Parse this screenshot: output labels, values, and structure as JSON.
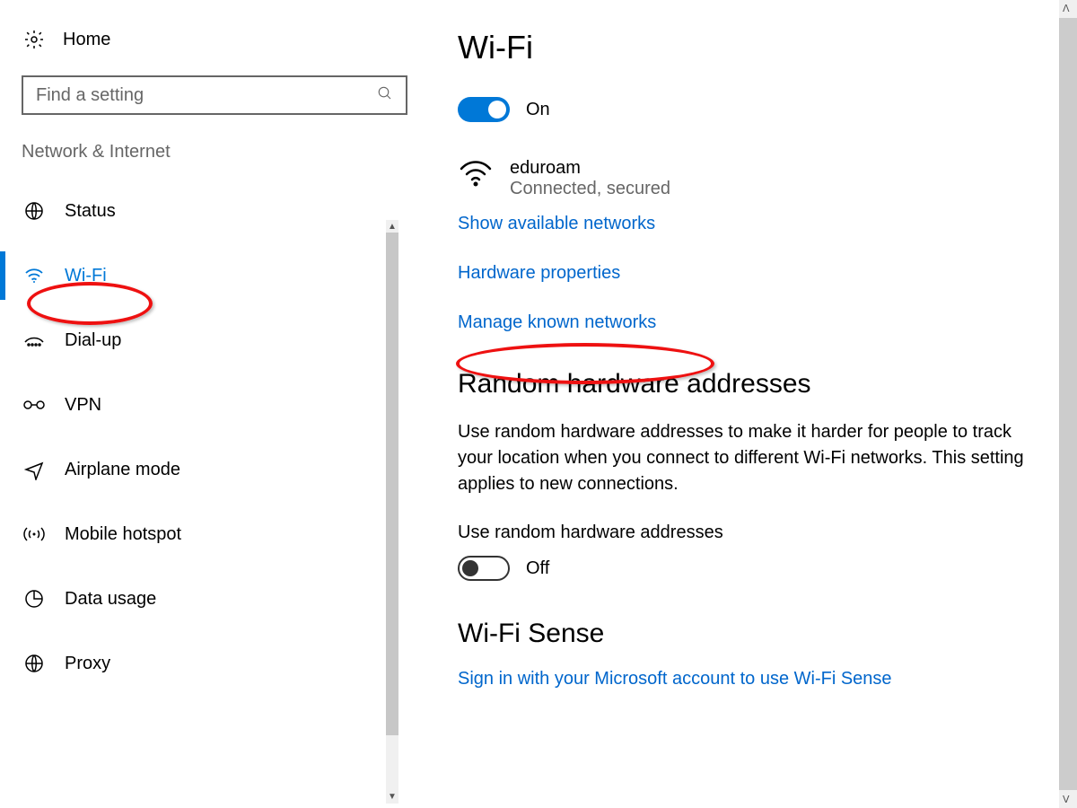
{
  "sidebar": {
    "home_label": "Home",
    "search_placeholder": "Find a setting",
    "category_label": "Network & Internet",
    "items": [
      {
        "id": "status",
        "label": "Status",
        "selected": false
      },
      {
        "id": "wifi",
        "label": "Wi-Fi",
        "selected": true
      },
      {
        "id": "dialup",
        "label": "Dial-up",
        "selected": false
      },
      {
        "id": "vpn",
        "label": "VPN",
        "selected": false
      },
      {
        "id": "airplane",
        "label": "Airplane mode",
        "selected": false
      },
      {
        "id": "hotspot",
        "label": "Mobile hotspot",
        "selected": false
      },
      {
        "id": "datausage",
        "label": "Data usage",
        "selected": false
      },
      {
        "id": "proxy",
        "label": "Proxy",
        "selected": false
      }
    ]
  },
  "main": {
    "title": "Wi-Fi",
    "wifi_toggle": {
      "state": "on",
      "label": "On"
    },
    "connected_network": {
      "ssid": "eduroam",
      "status": "Connected, secured"
    },
    "links": {
      "show_available": "Show available networks",
      "hardware_props": "Hardware properties",
      "manage_known": "Manage known networks"
    },
    "random_hw": {
      "heading": "Random hardware addresses",
      "description": "Use random hardware addresses to make it harder for people to track your location when you connect to different Wi-Fi networks. This setting applies to new connections.",
      "sub_label": "Use random hardware addresses",
      "toggle": {
        "state": "off",
        "label": "Off"
      }
    },
    "wifi_sense": {
      "heading": "Wi-Fi Sense",
      "signin_link": "Sign in with your Microsoft account to use Wi-Fi Sense"
    }
  }
}
